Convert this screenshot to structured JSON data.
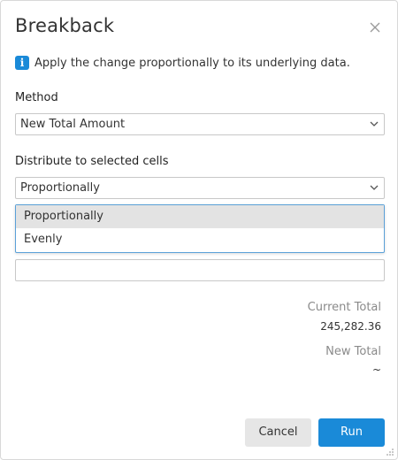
{
  "dialog": {
    "title": "Breakback",
    "info_text": "Apply the change proportionally to its underlying data."
  },
  "method": {
    "label": "Method",
    "value": "New Total Amount"
  },
  "distribute": {
    "label": "Distribute to selected cells",
    "value": "Proportionally",
    "options": [
      "Proportionally",
      "Evenly"
    ],
    "highlighted_option": "Proportionally"
  },
  "amount_input": {
    "value": ""
  },
  "totals": {
    "current_label": "Current Total",
    "current_value": "245,282.36",
    "new_label": "New Total",
    "new_value": "~"
  },
  "buttons": {
    "cancel": "Cancel",
    "run": "Run"
  },
  "colors": {
    "accent": "#1a8ad8",
    "option_highlight": "#e3e3e3"
  },
  "icons": {
    "info": "info-icon",
    "close": "close-icon",
    "chevron": "chevron-down-icon",
    "resize": "resize-grip-icon"
  }
}
